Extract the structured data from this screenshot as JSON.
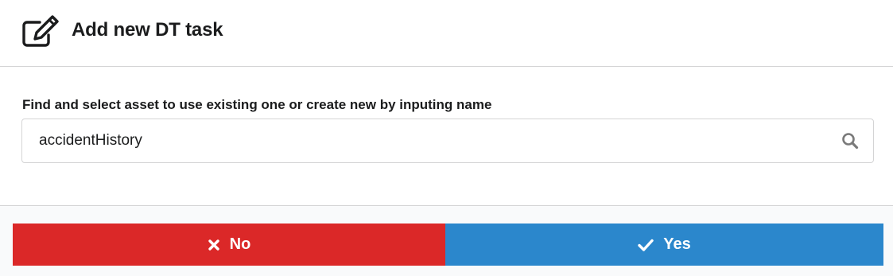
{
  "header": {
    "icon": "edit-icon",
    "title": "Add new DT task"
  },
  "form": {
    "label": "Find and select asset to use existing one or create new by inputing name",
    "search_value": "accidentHistory",
    "search_icon": "search-icon"
  },
  "actions": {
    "no_label": "No",
    "no_icon": "close-icon",
    "no_color": "#db2828",
    "yes_label": "Yes",
    "yes_icon": "checkmark-icon",
    "yes_color": "#2b87cc"
  }
}
